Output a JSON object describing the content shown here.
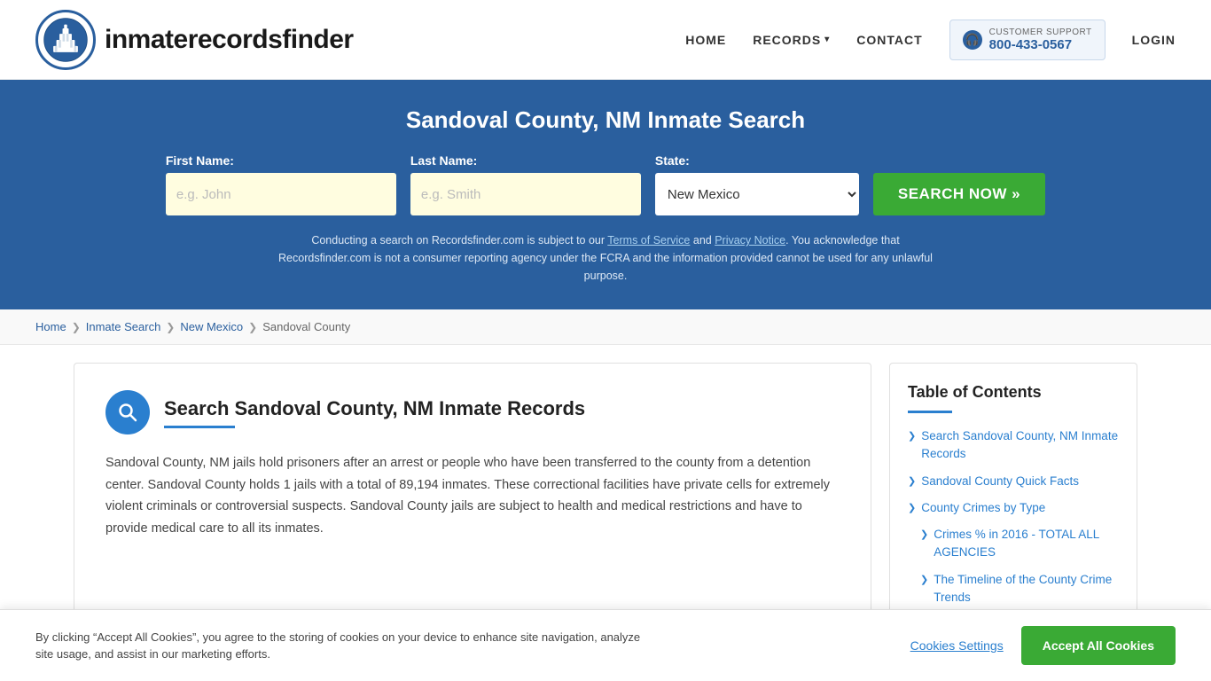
{
  "header": {
    "logo_text_light": "inmaterecords",
    "logo_text_bold": "finder",
    "nav": {
      "home": "HOME",
      "records": "RECORDS",
      "contact": "CONTACT",
      "login": "LOGIN"
    },
    "support": {
      "label": "CUSTOMER SUPPORT",
      "number": "800-433-0567"
    }
  },
  "hero": {
    "title": "Sandoval County, NM Inmate Search",
    "form": {
      "first_name_label": "First Name:",
      "first_name_placeholder": "e.g. John",
      "last_name_label": "Last Name:",
      "last_name_placeholder": "e.g. Smith",
      "state_label": "State:",
      "state_value": "New Mexico",
      "search_btn": "SEARCH NOW »"
    },
    "disclaimer": "Conducting a search on Recordsfinder.com is subject to our Terms of Service and Privacy Notice. You acknowledge that Recordsfinder.com is not a consumer reporting agency under the FCRA and the information provided cannot be used for any unlawful purpose."
  },
  "breadcrumb": {
    "items": [
      "Home",
      "Inmate Search",
      "New Mexico",
      "Sandoval County"
    ]
  },
  "article": {
    "icon": "🔍",
    "title": "Search Sandoval County, NM Inmate Records",
    "body": "Sandoval County, NM jails hold prisoners after an arrest or people who have been transferred to the county from a detention center. Sandoval County holds 1 jails with a total of 89,194 inmates. These correctional facilities have private cells for extremely violent criminals or controversial suspects. Sandoval County jails are subject to health and medical restrictions and have to provide medical care to all its inmates."
  },
  "toc": {
    "title": "Table of Contents",
    "items": [
      {
        "label": "Search Sandoval County, NM Inmate Records",
        "sub": false
      },
      {
        "label": "Sandoval County Quick Facts",
        "sub": false
      },
      {
        "label": "County Crimes by Type",
        "sub": false
      },
      {
        "label": "Crimes % in 2016 - TOTAL ALL AGENCIES",
        "sub": true
      },
      {
        "label": "The Timeline of the County Crime Trends",
        "sub": true
      }
    ]
  },
  "cookie_banner": {
    "text": "By clicking “Accept All Cookies”, you agree to the storing of cookies on your device to enhance site navigation, analyze site usage, and assist in our marketing efforts.",
    "settings_label": "Cookies Settings",
    "accept_label": "Accept All Cookies"
  }
}
